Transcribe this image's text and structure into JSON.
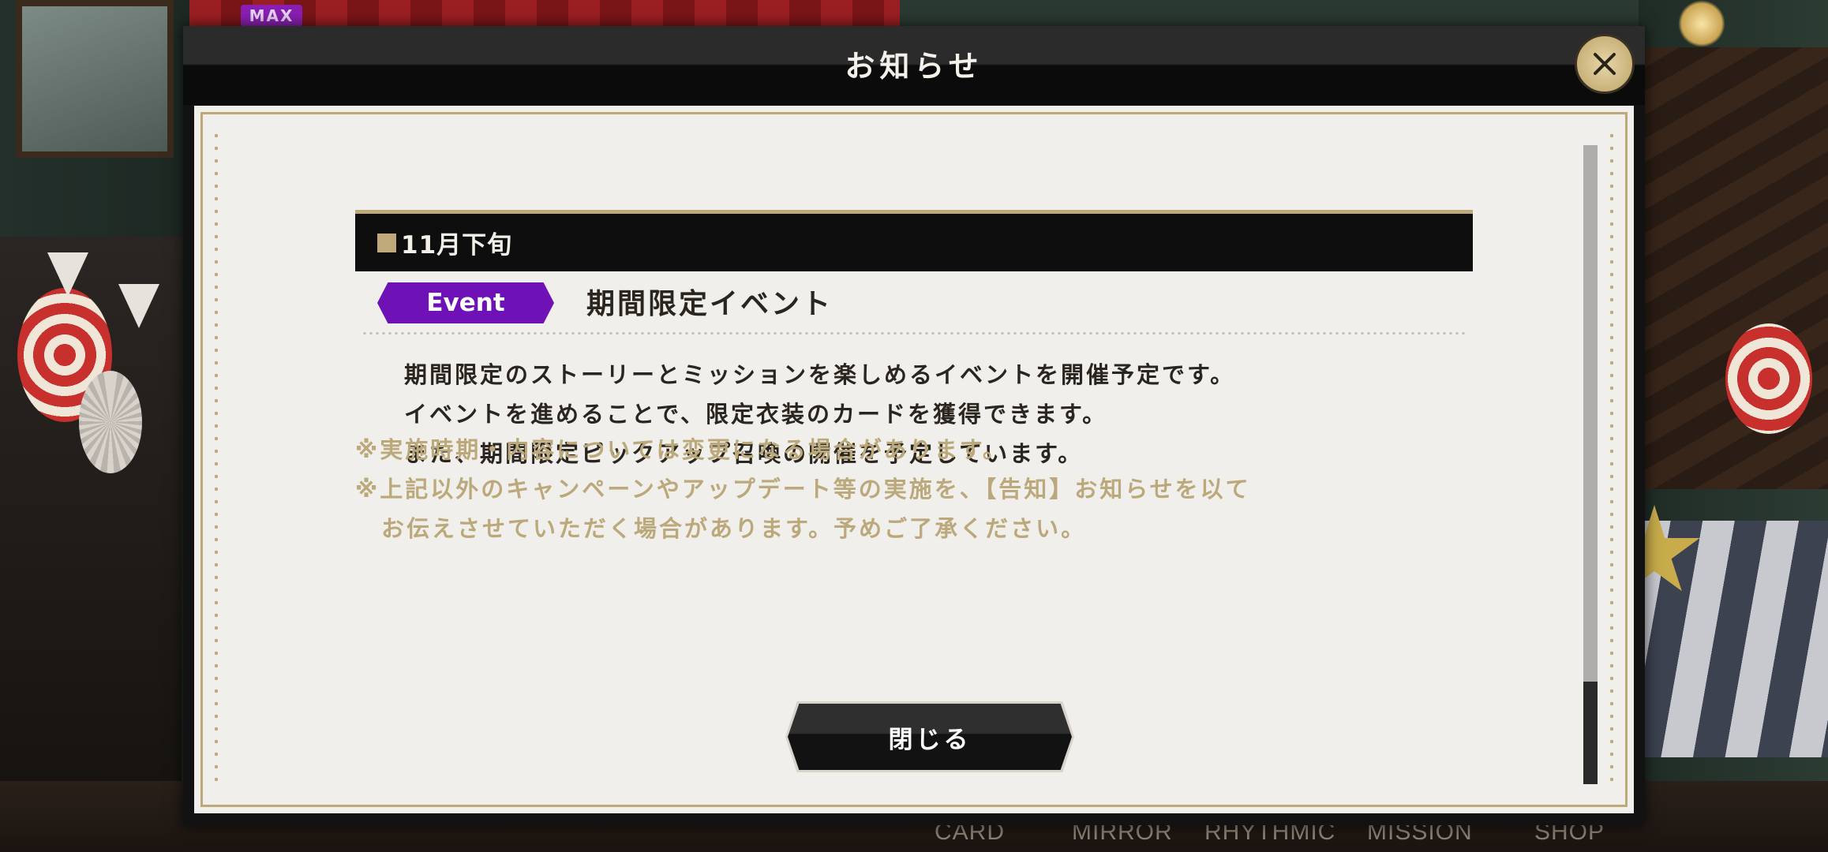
{
  "badge": {
    "max_label": "MAX"
  },
  "modal": {
    "title": "お知らせ",
    "section_title": "11月下旬",
    "event_badge": "Event",
    "event_title": "期間限定イベント",
    "body": [
      "期間限定のストーリーとミッションを楽しめるイベントを開催予定です。",
      "イベントを進めることで、限定衣装のカードを獲得できます。",
      "また、期間限定ピックアップ召喚の開催を予定しています。"
    ],
    "notes": [
      "※実施時期・内容については変更になる場合があります。",
      "※上記以外のキャンペーンやアップデート等の実施を、【告知】お知らせを以て",
      "お伝えさせていただく場合があります。予めご了承ください。"
    ],
    "close_button_label": "閉じる",
    "close_icon": "close-icon"
  },
  "bottom_nav": {
    "items": [
      "CARD",
      "MIRROR",
      "RHYTHMIC",
      "MISSION",
      "SHOP"
    ]
  },
  "colors": {
    "accent_gold": "#bfa97a",
    "event_purple": "#6e12b8",
    "note_text": "#bba97b",
    "body_text": "#2b2520"
  }
}
